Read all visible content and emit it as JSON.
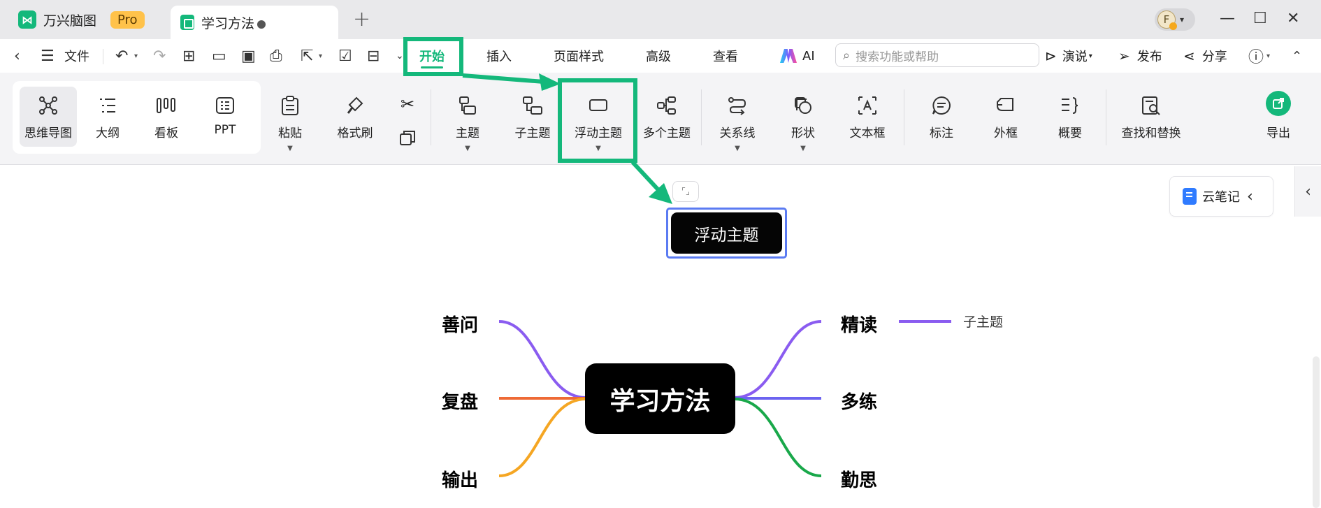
{
  "titlebar": {
    "app_name": "万兴脑图",
    "pro_badge": "Pro",
    "doc_tab": "学习方法"
  },
  "menubar": {
    "file": "文件",
    "tabs": [
      "开始",
      "插入",
      "页面样式",
      "高级",
      "查看"
    ],
    "ai": "AI",
    "search_placeholder": "搜索功能或帮助",
    "present": "演说",
    "publish": "发布",
    "share": "分享"
  },
  "ribbon": {
    "views": [
      "思维导图",
      "大纲",
      "看板",
      "PPT"
    ],
    "paste": "粘贴",
    "format_painter": "格式刷",
    "topic": "主题",
    "subtopic": "子主题",
    "floating_topic": "浮动主题",
    "multiple_topics": "多个主题",
    "relationship": "关系线",
    "shape": "形状",
    "textbox": "文本框",
    "callout": "标注",
    "boundary": "外框",
    "summary": "概要",
    "find_replace": "查找和替换",
    "export": "导出"
  },
  "canvas": {
    "cloud_note": "云笔记",
    "floating_topic": "浮动主题",
    "central_topic": "学习方法",
    "left_branches": [
      "善问",
      "复盘",
      "输出"
    ],
    "right_branches": [
      "精读",
      "多练",
      "勤思"
    ],
    "subtopic": "子主题"
  },
  "colors": {
    "accent": "#14b87b",
    "annotation": "#14b87b",
    "selection": "#5b7bf2",
    "branch_purple": "#8a5cf0",
    "branch_orange": "#ee6a35",
    "branch_yellow": "#f5a623",
    "branch_blue": "#6c63f0",
    "branch_green": "#19a84a"
  }
}
